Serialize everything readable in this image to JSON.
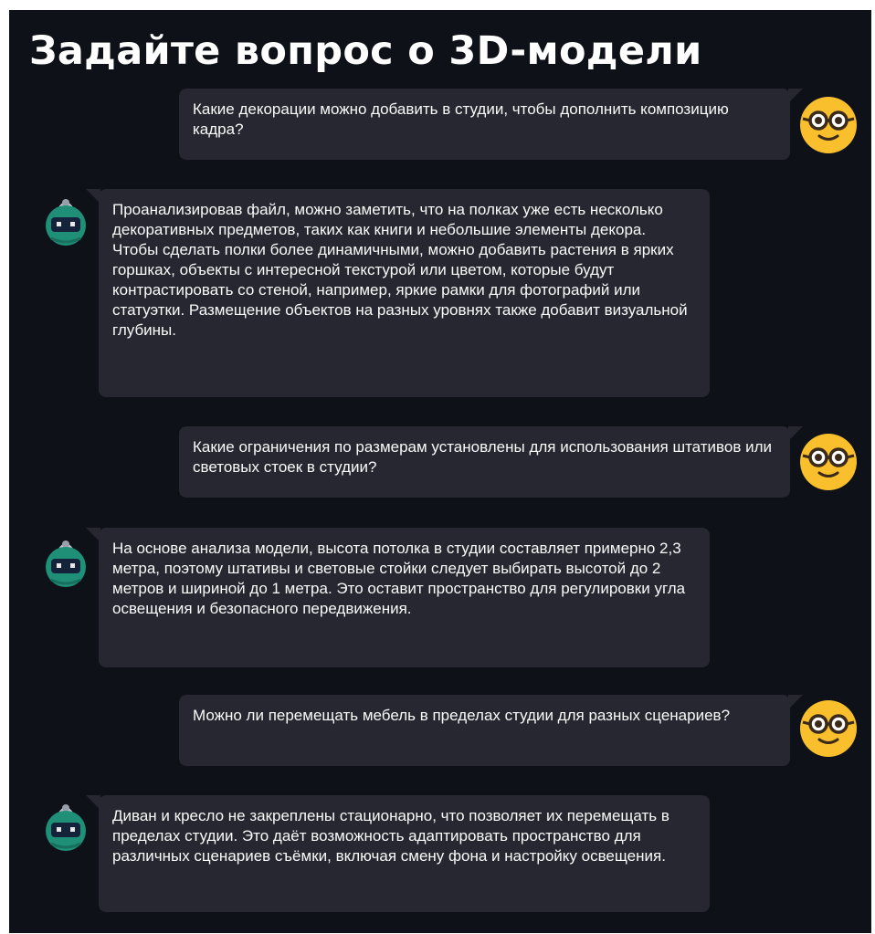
{
  "page": {
    "title": "Задайте вопрос о 3D-модели"
  },
  "messages": [
    {
      "role": "user",
      "avatar": "nerd-face-emoji-icon",
      "text": "Какие декорации можно добавить в студии, чтобы дополнить композицию кадра?"
    },
    {
      "role": "assistant",
      "avatar": "robot-avatar-icon",
      "text": "Проанализировав файл, можно заметить, что на полках уже есть несколько декоративных предметов, таких как книги и небольшие элементы декора.\nЧтобы сделать полки более динамичными, можно добавить растения в ярких горшках, объекты с интересной текстурой или цветом, которые будут контрастировать со стеной, например, яркие рамки для фотографий или статуэтки. Размещение объектов на разных уровнях также добавит визуальной глубины."
    },
    {
      "role": "user",
      "avatar": "nerd-face-emoji-icon",
      "text": "Какие ограничения по размерам установлены для использования штативов или световых стоек в студии?"
    },
    {
      "role": "assistant",
      "avatar": "robot-avatar-icon",
      "text": "На основе анализа модели, высота потолка в студии составляет примерно 2,3 метра, поэтому штативы и световые стойки следует выбирать высотой до 2 метров и шириной до 1 метра. Это оставит пространство для регулировки угла освещения и безопасного передвижения."
    },
    {
      "role": "user",
      "avatar": "nerd-face-emoji-icon",
      "text": "Можно ли перемещать мебель в пределах студии для разных сценариев?"
    },
    {
      "role": "assistant",
      "avatar": "robot-avatar-icon",
      "text": "Диван и кресло не закреплены стационарно, что позволяет их перемещать в пределах студии. Это даёт возможность адаптировать пространство для различных сценариев съёмки, включая смену фона и настройку освещения."
    }
  ],
  "colors": {
    "background": "#0e1117",
    "bubble": "#262730",
    "text": "#fafafa",
    "user_avatar": "#f9bf2c",
    "bot_avatar": "#1f8f78"
  }
}
